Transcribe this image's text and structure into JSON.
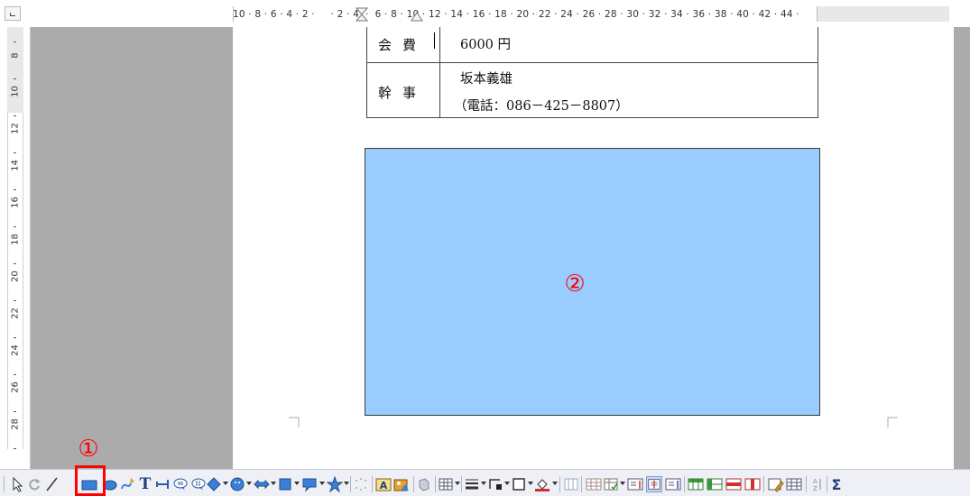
{
  "ruler": {
    "horizontal_ticks": "10 · 8 · 6 · 4 · 2 ·     · 2 · 4  ·  6 · 8 · 10 · 12 · 14 · 16 · 18 · 20 · 22 · 24 · 26 · 28 · 30 · 32 · 34 · 36 · 38 · 40 · 42 · 44 ·",
    "vertical_ticks": [
      "8",
      "10",
      "12",
      "14",
      "16",
      "18",
      "20",
      "22",
      "24",
      "26",
      "28"
    ]
  },
  "document": {
    "table": {
      "row1": {
        "label": "会費",
        "value": "6000 円"
      },
      "row2": {
        "label": "幹事",
        "name": "坂本義雄",
        "phone": "（電話：086－425－8807）"
      }
    },
    "shape": {
      "fill_color": "#99ccff",
      "marker": "②"
    }
  },
  "annotations": {
    "marker1": "①",
    "marker_color": "#ff0000"
  },
  "toolbar": {
    "icons": [
      "select-icon",
      "rotate-icon",
      "line-icon",
      "rectangle-icon",
      "ellipse-icon",
      "freeform-icon",
      "text-icon",
      "dimension-line-icon",
      "callout-icon",
      "vertical-callout-icon",
      "basic-shapes-icon",
      "symbol-shapes-icon",
      "block-arrows-icon",
      "flowchart-icon",
      "callouts-icon",
      "stars-icon",
      "points-icon",
      "fontwork-icon",
      "insert-image-icon",
      "extrusion-icon",
      "table-icon",
      "line-style-icon",
      "arrow-style-icon",
      "border-icon",
      "fill-color-icon",
      "table-grid-icon",
      "autoformat-icon",
      "insert-row-icon",
      "insert-column-icon",
      "delete-row-icon",
      "delete-column-icon",
      "merge-cells-icon",
      "split-cells-icon",
      "properties-icon",
      "sort-icon",
      "sum-icon"
    ]
  }
}
